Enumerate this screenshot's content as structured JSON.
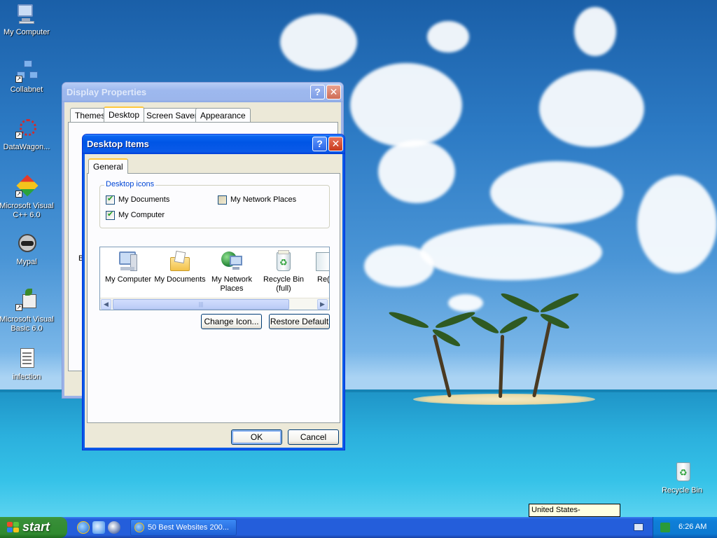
{
  "desktop_icons": [
    {
      "label": "My Computer",
      "icon": "my-computer-icon"
    },
    {
      "label": "Collabnet",
      "icon": "network-shortcut-icon"
    },
    {
      "label": "DataWagon...",
      "icon": "datawagon-shortcut-icon"
    },
    {
      "label": "Microsoft Visual C++ 6.0",
      "icon": "visual-cpp-icon"
    },
    {
      "label": "Mypal",
      "icon": "mypal-icon"
    },
    {
      "label": "Microsoft Visual Basic 6.0",
      "icon": "visual-basic-icon"
    },
    {
      "label": "infection",
      "icon": "text-file-icon"
    },
    {
      "label": "Recycle Bin",
      "icon": "recycle-bin-icon"
    }
  ],
  "display_properties": {
    "title": "Display Properties",
    "tabs": [
      "Themes",
      "Desktop",
      "Screen Saver",
      "Appearance"
    ],
    "active_tab": "Desktop",
    "side_char": "B"
  },
  "desktop_items": {
    "title": "Desktop Items",
    "tab": "General",
    "group_label": "Desktop icons",
    "checkboxes": [
      {
        "label": "My Documents",
        "checked": true
      },
      {
        "label": "My Network Places",
        "checked": false
      },
      {
        "label": "My Computer",
        "checked": true
      }
    ],
    "icon_list": [
      {
        "label": "My Computer",
        "icon": "my-computer-icon"
      },
      {
        "label": "My Documents",
        "icon": "my-documents-icon"
      },
      {
        "label": "My Network Places",
        "icon": "network-places-icon"
      },
      {
        "label": "Recycle Bin (full)",
        "icon": "recycle-bin-full-icon"
      },
      {
        "label": "Re(",
        "icon": "recycle-bin-empty-icon"
      }
    ],
    "buttons": {
      "change_icon": "Change Icon...",
      "restore_default": "Restore Default",
      "ok": "OK",
      "cancel": "Cancel"
    },
    "help_glyph": "?",
    "close_glyph": "✕"
  },
  "taskbar": {
    "start_label": "start",
    "task_button_label": "50 Best Websites 200...",
    "clock": "6:26 AM",
    "language_tooltip": "United States-International"
  },
  "colors": {
    "title_active": "#0a5ae8",
    "start_green": "#388e38",
    "taskbar_blue": "#245edb",
    "groupbox_legend": "#0046d5"
  }
}
